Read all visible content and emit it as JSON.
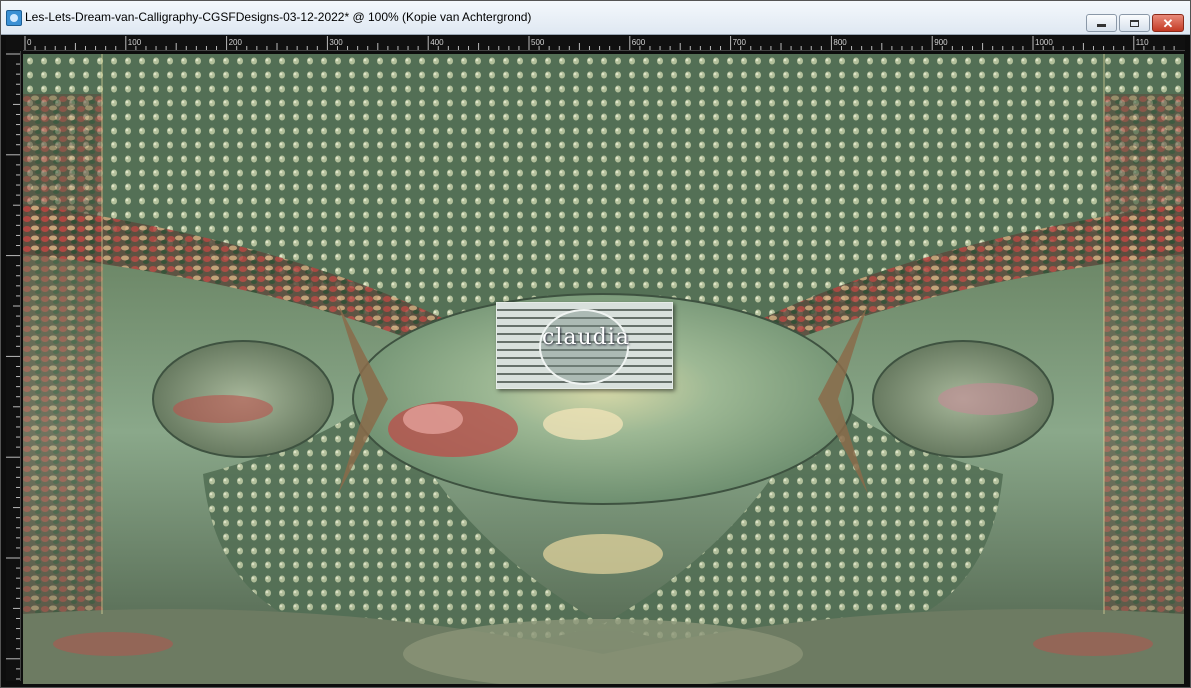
{
  "window": {
    "title": "Les-Lets-Dream-van-Calligraphy-CGSFDesigns-03-12-2022* @ 100% (Kopie van Achtergrond)",
    "controls": {
      "minimize_icon": "minimize-icon",
      "maximize_icon": "maximize-icon",
      "close_icon": "close-icon",
      "close_glyph": "✕"
    }
  },
  "ruler": {
    "horizontal_labels": [
      "0",
      "100",
      "200",
      "300",
      "400",
      "500",
      "600",
      "700",
      "800",
      "900",
      "1000",
      "110"
    ]
  },
  "canvas": {
    "image_description_icon": "artwork-image",
    "watermark_text": "claudia"
  },
  "colors": {
    "titlebar": "#e8eff6",
    "close_button": "#c33b25",
    "canvas_green": "#5f7a5c"
  }
}
